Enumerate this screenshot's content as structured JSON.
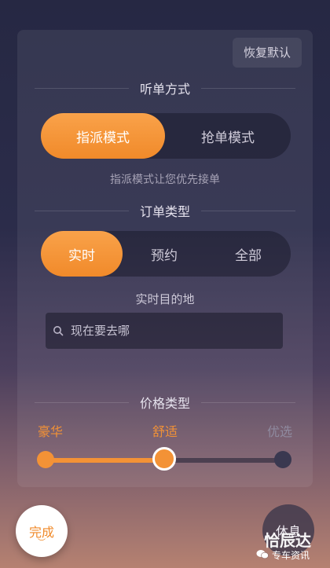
{
  "panel": {
    "reset_label": "恢复默认",
    "listen_title": "听单方式",
    "listen_modes": [
      "指派模式",
      "抢单模式"
    ],
    "listen_active_index": 0,
    "listen_hint": "指派模式让您优先接单",
    "order_title": "订单类型",
    "order_types": [
      "实时",
      "预约",
      "全部"
    ],
    "order_active_index": 0,
    "destination_title": "实时目的地",
    "destination_placeholder": "现在要去哪",
    "price_title": "价格类型",
    "price_levels": [
      "豪华",
      "舒适",
      "优选"
    ],
    "price_selected_fraction": 0.5
  },
  "bottom": {
    "done_label": "完成",
    "rest_label": "休息"
  },
  "watermark": {
    "brand": "恰辰达",
    "source": "专车资讯"
  },
  "colors": {
    "accent": "#f39236",
    "active_text": "#ffffff",
    "inactive_price_label": "#8f8a9f"
  }
}
